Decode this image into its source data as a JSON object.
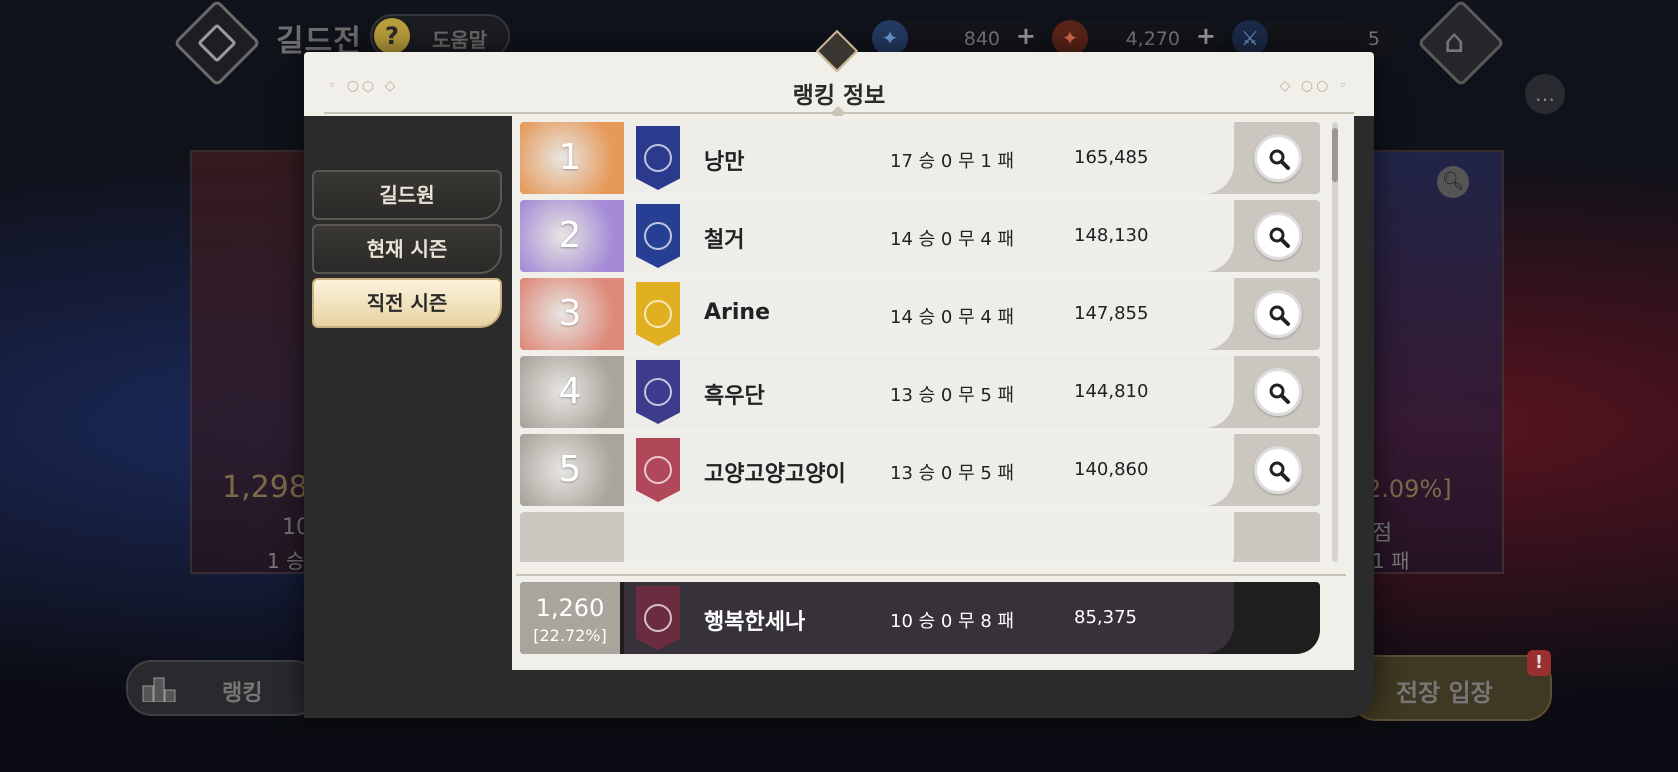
{
  "header": {
    "title": "길드전",
    "help_icon": "question-icon",
    "help_label": "도움말",
    "resources": [
      {
        "icon": "compass-icon",
        "value": "840",
        "has_plus": true,
        "color": "#3a5f9e"
      },
      {
        "icon": "red-compass-icon",
        "value": "4,270",
        "has_plus": true,
        "color": "#9b3b2b"
      },
      {
        "icon": "crossed-swords-icon",
        "value": "5",
        "has_plus": false,
        "color": "#4d7ab8"
      }
    ],
    "home_icon": "home-icon"
  },
  "background": {
    "left": {
      "score": "1,298",
      "line2": "10",
      "line3": "1 승"
    },
    "right": {
      "pct": "2.09%]",
      "line2": "점",
      "line3": "1 패"
    }
  },
  "bottom": {
    "rank_label": "랭킹",
    "enter_label": "전장 입장",
    "alert": "!"
  },
  "modal": {
    "title": "랭킹 정보",
    "tabs": [
      {
        "label": "길드원",
        "active": false
      },
      {
        "label": "현재 시즌",
        "active": false
      },
      {
        "label": "직전 시즌",
        "active": true
      }
    ],
    "rows": [
      {
        "rank": "1",
        "name": "낭만",
        "record": "17 승 0 무 1 패",
        "score": "165,485",
        "rank_color": "#e69a5a",
        "banner_color": "#2b3a8c"
      },
      {
        "rank": "2",
        "name": "철거",
        "record": "14 승 0 무 4 패",
        "score": "148,130",
        "rank_color": "#a58bd6",
        "banner_color": "#263f94"
      },
      {
        "rank": "3",
        "name": "Arine",
        "record": "14 승 0 무 4 패",
        "score": "147,855",
        "rank_color": "#de8a7a",
        "banner_color": "#e0b020"
      },
      {
        "rank": "4",
        "name": "흑우단",
        "record": "13 승 0 무 5 패",
        "score": "144,810",
        "rank_color": "#a9a49c",
        "banner_color": "#3c3b8c"
      },
      {
        "rank": "5",
        "name": "고양고양고양이",
        "record": "13 승 0 무 5 패",
        "score": "140,860",
        "rank_color": "#a9a49c",
        "banner_color": "#b0485a"
      }
    ],
    "my_row": {
      "rank": "1,260",
      "pct": "[22.72%]",
      "name": "행복한세나",
      "record": "10 승 0 무 8 패",
      "score": "85,375",
      "banner_color": "#6b2c3f"
    }
  }
}
